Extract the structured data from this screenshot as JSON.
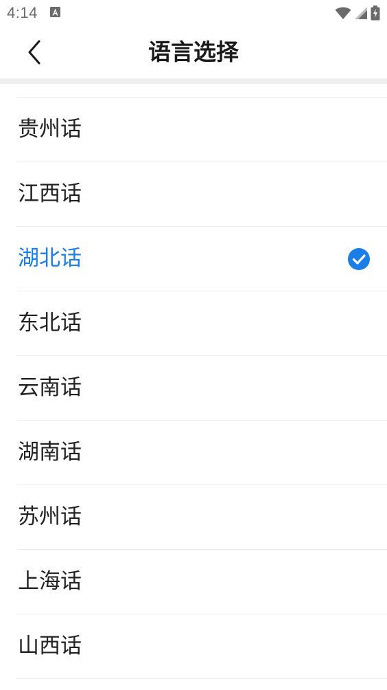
{
  "status_bar": {
    "time": "4:14",
    "icons": [
      "a-notification-icon",
      "wifi-icon",
      "signal-icon",
      "battery-charging-icon"
    ]
  },
  "header": {
    "back_icon": "chevron-left-icon",
    "title": "语言选择"
  },
  "languages": {
    "selected_color": "#1a7ee6",
    "items": [
      {
        "label": "贵州话",
        "selected": false
      },
      {
        "label": "江西话",
        "selected": false
      },
      {
        "label": "湖北话",
        "selected": true
      },
      {
        "label": "东北话",
        "selected": false
      },
      {
        "label": "云南话",
        "selected": false
      },
      {
        "label": "湖南话",
        "selected": false
      },
      {
        "label": "苏州话",
        "selected": false
      },
      {
        "label": "上海话",
        "selected": false
      },
      {
        "label": "山西话",
        "selected": false
      }
    ]
  }
}
